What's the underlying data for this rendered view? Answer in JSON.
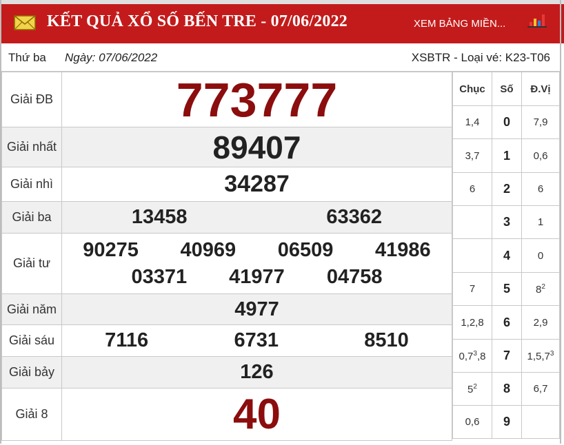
{
  "header": {
    "title": "KẾT QUẢ XỔ SỐ BẾN TRE - 07/06/2022",
    "region_link": "XEM BẢNG MIỀN...",
    "colors": {
      "primary": "#c31b1b",
      "special": "#8b0d0d"
    },
    "icons": [
      "mail-icon",
      "bar-chart-icon"
    ]
  },
  "info": {
    "weekday": "Thứ ba",
    "date": "Ngày: 07/06/2022",
    "ticket": "XSBTR - Loại vé: K23-T06"
  },
  "prizes": {
    "db": {
      "label": "Giải ĐB",
      "numbers": [
        "773777"
      ]
    },
    "nhat": {
      "label": "Giải nhất",
      "numbers": [
        "89407"
      ]
    },
    "nhi": {
      "label": "Giải nhì",
      "numbers": [
        "34287"
      ]
    },
    "ba": {
      "label": "Giải ba",
      "numbers": [
        "13458",
        "63362"
      ]
    },
    "tu": {
      "label": "Giải tư",
      "numbers": [
        "90275",
        "40969",
        "06509",
        "41986",
        "03371",
        "41977",
        "04758"
      ]
    },
    "nam": {
      "label": "Giải năm",
      "numbers": [
        "4977"
      ]
    },
    "sau": {
      "label": "Giải sáu",
      "numbers": [
        "7116",
        "6731",
        "8510"
      ]
    },
    "bay": {
      "label": "Giải bảy",
      "numbers": [
        "126"
      ]
    },
    "tam": {
      "label": "Giải 8",
      "numbers": [
        "40"
      ]
    }
  },
  "loto": {
    "headers": [
      "Chục",
      "Số",
      "Đ.Vị"
    ],
    "rows": [
      {
        "chuc": "1,4",
        "so": "0",
        "dvi": "7,9"
      },
      {
        "chuc": "3,7",
        "so": "1",
        "dvi": "0,6"
      },
      {
        "chuc": "6",
        "so": "2",
        "dvi": "6"
      },
      {
        "chuc": "",
        "so": "3",
        "dvi": "1"
      },
      {
        "chuc": "",
        "so": "4",
        "dvi": "0"
      },
      {
        "chuc": "7",
        "so": "5",
        "dvi": "8",
        "dvi_sup": "2"
      },
      {
        "chuc": "1,2,8",
        "so": "6",
        "dvi": "2,9"
      },
      {
        "chuc": "0,7",
        "chuc_sup": "3",
        "chuc_tail": ",8",
        "so": "7",
        "dvi": "1,5,7",
        "dvi_sup": "3"
      },
      {
        "chuc": "5",
        "chuc_sup": "2",
        "so": "8",
        "dvi": "6,7"
      },
      {
        "chuc": "0,6",
        "so": "9",
        "dvi": ""
      }
    ]
  }
}
